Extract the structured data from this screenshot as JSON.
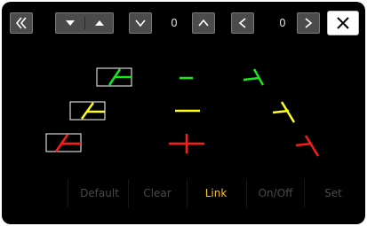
{
  "toolbar": {
    "back_icon": "double-chevron-left-icon",
    "value_1": "0",
    "value_2": "0",
    "close_icon": "close-x-icon"
  },
  "menu": {
    "default_label": "Default",
    "clear_label": "Clear",
    "link_label": "Link",
    "onoff_label": "On/Off",
    "set_label": "Set"
  },
  "colors": {
    "green": "#1ce61c",
    "yellow": "#ffff1a",
    "red": "#ff1a1a",
    "active": "#ffc21a",
    "button": "#4b4b4b"
  }
}
